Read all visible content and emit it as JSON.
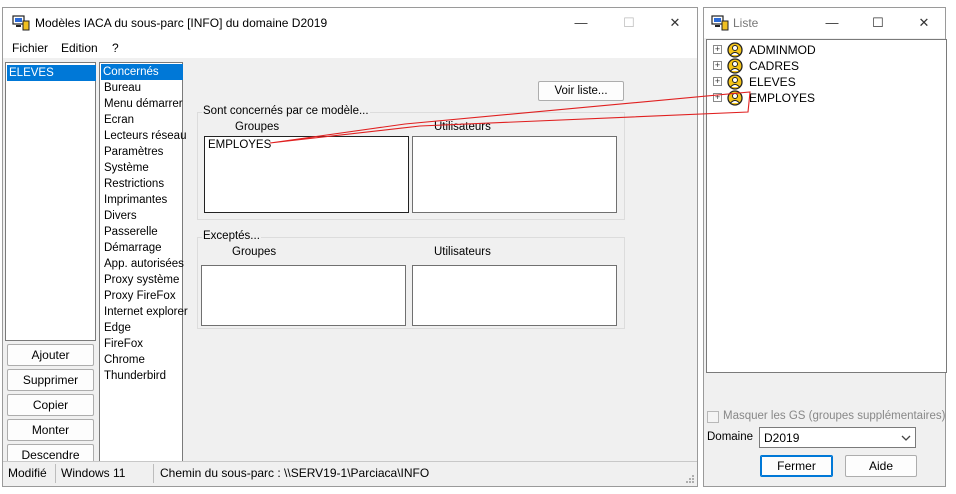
{
  "main_window": {
    "title": "Modèles IACA du sous-parc [INFO] du domaine D2019",
    "controls": {
      "minimize": "—",
      "maximize": "☐",
      "close": "✕"
    },
    "menu": [
      "Fichier",
      "Edition",
      "?"
    ],
    "left_list": [
      "ELEVES"
    ],
    "buttons": [
      "Ajouter",
      "Supprimer",
      "Copier",
      "Monter",
      "Descendre"
    ],
    "categories": [
      "Concernés",
      "Bureau",
      "Menu démarrer",
      "Ecran",
      "Lecteurs réseau",
      "Paramètres",
      "Système",
      "Restrictions",
      "Imprimantes",
      "Divers",
      "Passerelle",
      "Démarrage",
      "App. autorisées",
      "Proxy système",
      "Proxy FireFox",
      "Internet explorer",
      "Edge",
      "FireFox",
      "Chrome",
      "Thunderbird"
    ],
    "voir_liste": "Voir liste...",
    "concerned": {
      "label": "Sont concernés par ce modèle...",
      "groups_label": "Groupes",
      "users_label": "Utilisateurs",
      "groups": [
        "EMPLOYES"
      ],
      "users": []
    },
    "excepted": {
      "label": "Exceptés...",
      "groups_label": "Groupes",
      "users_label": "Utilisateurs",
      "groups": [],
      "users": []
    },
    "status": {
      "state": "Modifié",
      "os": "Windows 11",
      "path": "Chemin du sous-parc : \\\\SERV19-1\\Parciaca\\INFO"
    }
  },
  "list_window": {
    "title": "Liste",
    "tree": [
      "ADMINMOD",
      "CADRES",
      "ELEVES",
      "EMPLOYES"
    ],
    "checkbox_label": "Masquer les GS (groupes supplémentaires)",
    "checkbox_checked": false,
    "domain_label": "Domaine",
    "domain_value": "D2019",
    "close_button": "Fermer",
    "help_button": "Aide"
  },
  "colors": {
    "selection": "#0078d7",
    "drag_line": "#e02020"
  }
}
